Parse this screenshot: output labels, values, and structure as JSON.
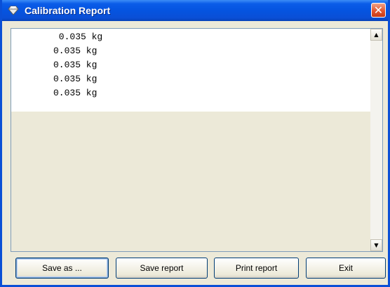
{
  "window": {
    "title": "Calibration Report",
    "close_glyph": "✕"
  },
  "report": {
    "lines": [
      " 0.035 kg",
      "0.035 kg",
      "0.035 kg",
      "0.035 kg",
      "0.035 kg"
    ]
  },
  "scrollbar": {
    "up_glyph": "▲",
    "down_glyph": "▼"
  },
  "buttons": {
    "save_as": "Save as ...",
    "save_report": "Save report",
    "print_report": "Print report",
    "exit": "Exit"
  },
  "colors": {
    "titlebar": "#0a4fd6",
    "close": "#e3562f",
    "face": "#ece9d8"
  }
}
